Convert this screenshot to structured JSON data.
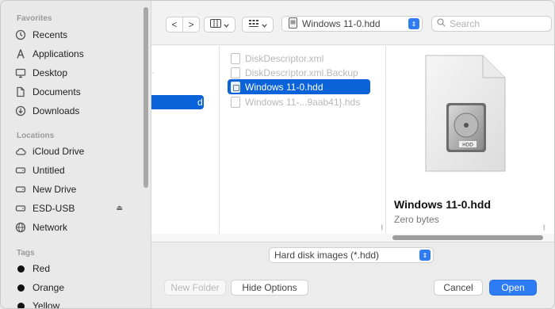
{
  "sidebar": {
    "favorites_heading": "Favorites",
    "favorites": [
      {
        "label": "Recents",
        "icon": "clock-icon"
      },
      {
        "label": "Applications",
        "icon": "applications-icon"
      },
      {
        "label": "Desktop",
        "icon": "desktop-icon"
      },
      {
        "label": "Documents",
        "icon": "document-icon"
      },
      {
        "label": "Downloads",
        "icon": "download-icon"
      }
    ],
    "locations_heading": "Locations",
    "locations": [
      {
        "label": "iCloud Drive",
        "icon": "cloud-icon"
      },
      {
        "label": "Untitled",
        "icon": "disk-icon"
      },
      {
        "label": "New Drive",
        "icon": "disk-icon"
      },
      {
        "label": "ESD-USB",
        "icon": "disk-icon",
        "eject_icon": "⏏"
      },
      {
        "label": "Network",
        "icon": "globe-icon"
      }
    ],
    "tags_heading": "Tags",
    "tags": [
      {
        "label": "Red",
        "color": "#111111"
      },
      {
        "label": "Orange",
        "color": "#111111"
      },
      {
        "label": "Yellow",
        "color": "#111111"
      }
    ]
  },
  "toolbar": {
    "back_label": "<",
    "forward_label": ">",
    "location": "Windows 11-0.hdd",
    "search_placeholder": "Search"
  },
  "browser": {
    "column1_selected_fragment": "d",
    "column1_ghost": "-",
    "files": [
      {
        "name": "DiskDescriptor.xml",
        "selected": false
      },
      {
        "name": "DiskDescriptor.xml.Backup",
        "selected": false
      },
      {
        "name": "Windows 11-0.hdd",
        "selected": true
      },
      {
        "name": "Windows 11-...9aab41}.hds",
        "selected": false
      }
    ],
    "preview": {
      "name": "Windows 11-0.hdd",
      "size": "Zero bytes",
      "icon_label": "HDD"
    }
  },
  "format": {
    "selected": "Hard disk images (*.hdd)"
  },
  "buttons": {
    "new_folder": "New Folder",
    "hide_options": "Hide Options",
    "cancel": "Cancel",
    "open": "Open"
  },
  "colors": {
    "accent": "#2d7bf5",
    "selection": "#0a63d8"
  }
}
